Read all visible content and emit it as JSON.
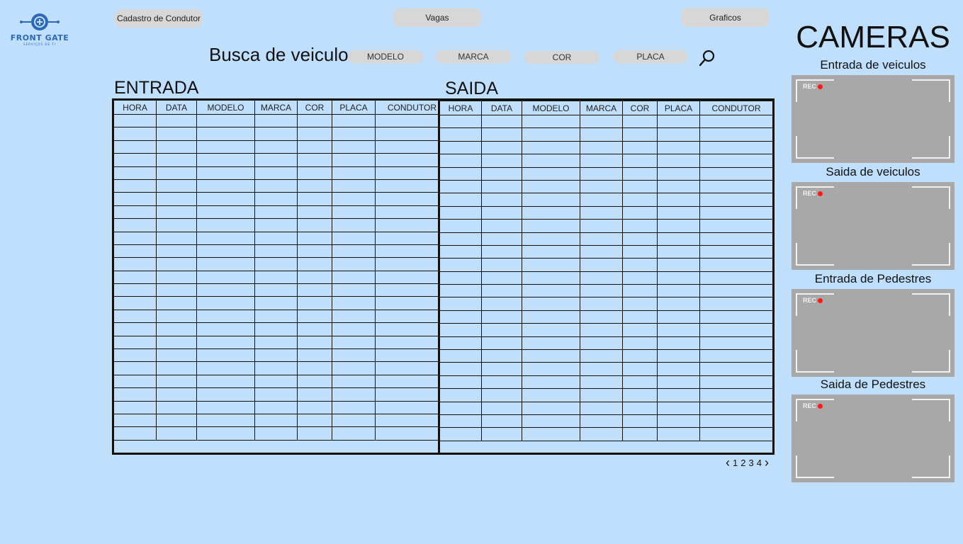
{
  "brand": {
    "name": "FRONT GATE",
    "tagline": "SERVIÇOS DE TI",
    "color": "#2f69b5"
  },
  "nav": {
    "cadastro": "Cadastro de Condutor",
    "vagas": "Vagas",
    "graficos": "Graficos"
  },
  "search": {
    "title": "Busca de veiculo",
    "filters": [
      "MODELO",
      "MARCA",
      "COR",
      "PLACA"
    ]
  },
  "entrada": {
    "title": "ENTRADA",
    "columns": [
      "HORA",
      "DATA",
      "MODELO",
      "MARCA",
      "COR",
      "PLACA",
      "CONDUTOR"
    ]
  },
  "saida": {
    "title": "SAIDA",
    "columns": [
      "HORA",
      "DATA",
      "MODELO",
      "MARCA",
      "COR",
      "PLACA",
      "CONDUTOR"
    ]
  },
  "pagination": {
    "prev": "‹",
    "pages": [
      "1",
      "2",
      "3",
      "4"
    ],
    "next": "›"
  },
  "cameras": {
    "title": "CAMERAS",
    "rec_label": "REC",
    "feeds": [
      {
        "label": "Entrada de veiculos"
      },
      {
        "label": "Saida de veiculos"
      },
      {
        "label": "Entrada de Pedestres"
      },
      {
        "label": "Saida de Pedestres"
      }
    ]
  },
  "colors": {
    "background": "#bfdffd",
    "pill": "#d7d7d7",
    "camera": "#a8a8a8",
    "rec_dot": "#ff1a1a"
  }
}
